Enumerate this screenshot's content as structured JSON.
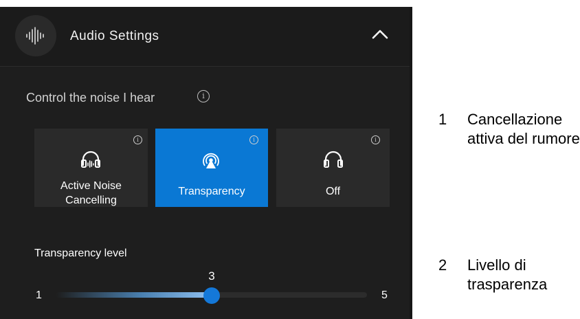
{
  "header": {
    "title": "Audio Settings",
    "app_icon": "audio-wave-icon",
    "collapse_icon": "chevron-up-icon"
  },
  "noise": {
    "label": "Control the noise I hear",
    "info_icon": "info-icon",
    "modes": [
      {
        "line1": "Active Noise",
        "line2": "Cancelling",
        "icon": "headphones-anc-icon",
        "active": false
      },
      {
        "label": "Transparency",
        "icon": "transparency-icon",
        "active": true
      },
      {
        "label": "Off",
        "icon": "headphones-icon",
        "active": false
      }
    ]
  },
  "slider": {
    "title": "Transparency level",
    "min": "1",
    "max": "5",
    "value": "3",
    "fraction": 0.5
  },
  "callouts": [
    {
      "number": "1",
      "text": "Cancellazione attiva del rumore"
    },
    {
      "number": "2",
      "text": "Livello di trasparenza"
    }
  ],
  "colors": {
    "accent": "#0a78d4",
    "panel": "#1e1e1e",
    "tile": "#2a2a2a"
  }
}
